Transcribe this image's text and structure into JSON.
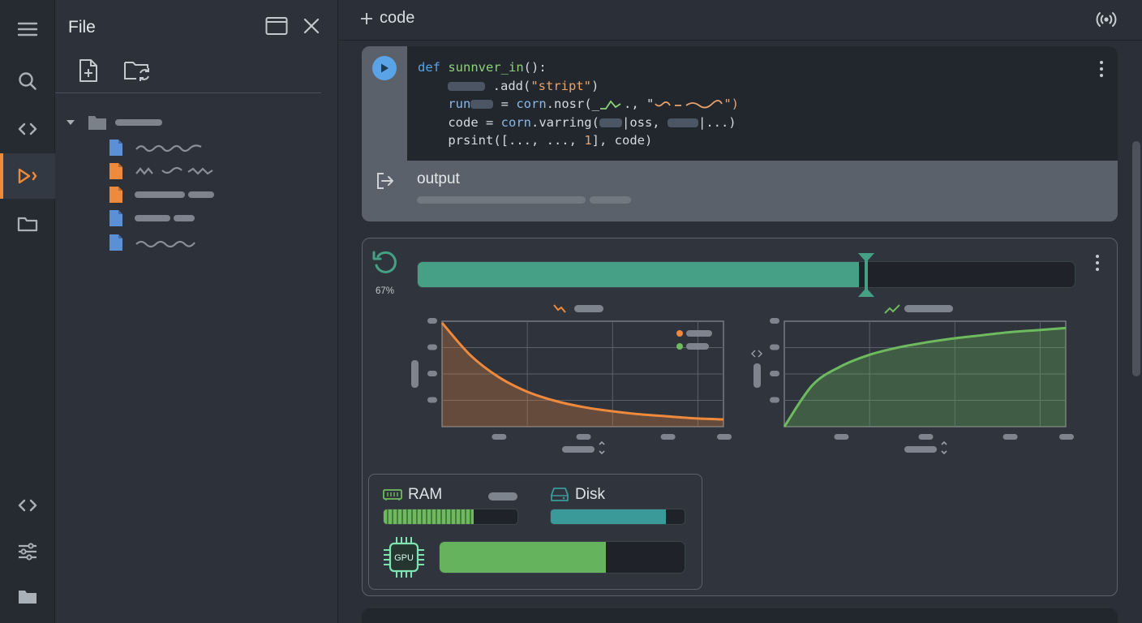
{
  "activity_bar": {
    "items": [
      "menu-icon",
      "search-icon",
      "code-icon",
      "run-debug-icon",
      "folder-icon"
    ],
    "bottom_items": [
      "code-icon",
      "sliders-icon",
      "folder-icon"
    ],
    "active": "run-debug-icon",
    "accent_color": "#ef8a3c"
  },
  "sidebar": {
    "title": "File",
    "tree": {
      "files": [
        {
          "color": "#5b8fd6"
        },
        {
          "color": "#ef8a3c"
        },
        {
          "color": "#ef8a3c"
        },
        {
          "color": "#5b8fd6"
        },
        {
          "color": "#5b8fd6"
        }
      ]
    }
  },
  "toolbar": {
    "add_code_label": "code"
  },
  "cell1": {
    "code": {
      "l1_def": "def",
      "l1_name": "sunnver_in",
      "l1_rest": "():",
      "l2_rest": ".add(",
      "l2_str": "\"stript\"",
      "l2_close": ")",
      "l3_a": "run",
      "l3_b": " = ",
      "l3_corn": "corn",
      "l3_c": ".nosr(_",
      "l3_d": "., \"",
      "l3_e": "\")",
      "l4_a": "code = ",
      "l4_corn": "corn",
      "l4_b": ".varring(",
      "l4_c": "|oss, ",
      "l4_d": "|...)",
      "l5_a": "prsint([..., ..., ",
      "l5_num": "1",
      "l5_b": "], code)"
    },
    "output_label": "output"
  },
  "cell2": {
    "progress": {
      "value": 0.67,
      "label": "67%",
      "color": "#45a085"
    },
    "resources": {
      "ram": {
        "label": "RAM",
        "fraction": 0.67,
        "color": "#6dbb5e"
      },
      "disk": {
        "label": "Disk",
        "fraction": 0.86,
        "color": "#3a9a9a"
      },
      "gpu": {
        "label": "GPU",
        "fraction": 0.68,
        "color": "#66b35d"
      }
    }
  },
  "chart_data": [
    {
      "type": "area",
      "series": [
        {
          "x": [
            0,
            0.1,
            0.2,
            0.3,
            0.4,
            0.5,
            0.6,
            0.7,
            0.8,
            0.9,
            1.0
          ],
          "values": [
            1.0,
            0.69,
            0.48,
            0.34,
            0.25,
            0.19,
            0.15,
            0.12,
            0.1,
            0.08,
            0.07
          ]
        }
      ],
      "color": "#ef8a3c",
      "grid": true,
      "legend": "top-right"
    },
    {
      "type": "area",
      "series": [
        {
          "x": [
            0,
            0.1,
            0.2,
            0.3,
            0.4,
            0.5,
            0.6,
            0.7,
            0.8,
            0.9,
            1.0
          ],
          "values": [
            0.0,
            0.4,
            0.58,
            0.69,
            0.76,
            0.81,
            0.85,
            0.88,
            0.91,
            0.93,
            0.95
          ]
        }
      ],
      "color": "#6dbb5e",
      "grid": true
    }
  ]
}
